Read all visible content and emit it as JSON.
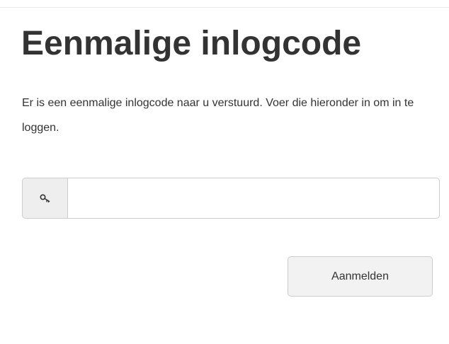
{
  "login": {
    "title": "Eenmalige inlogcode",
    "instructions": "Er is een eenmalige inlogcode naar u verstuurd. Voer die hieronder in om in te loggen.",
    "code_input": {
      "value": "",
      "placeholder": "",
      "icon": "key-icon"
    },
    "submit_label": "Aanmelden"
  }
}
